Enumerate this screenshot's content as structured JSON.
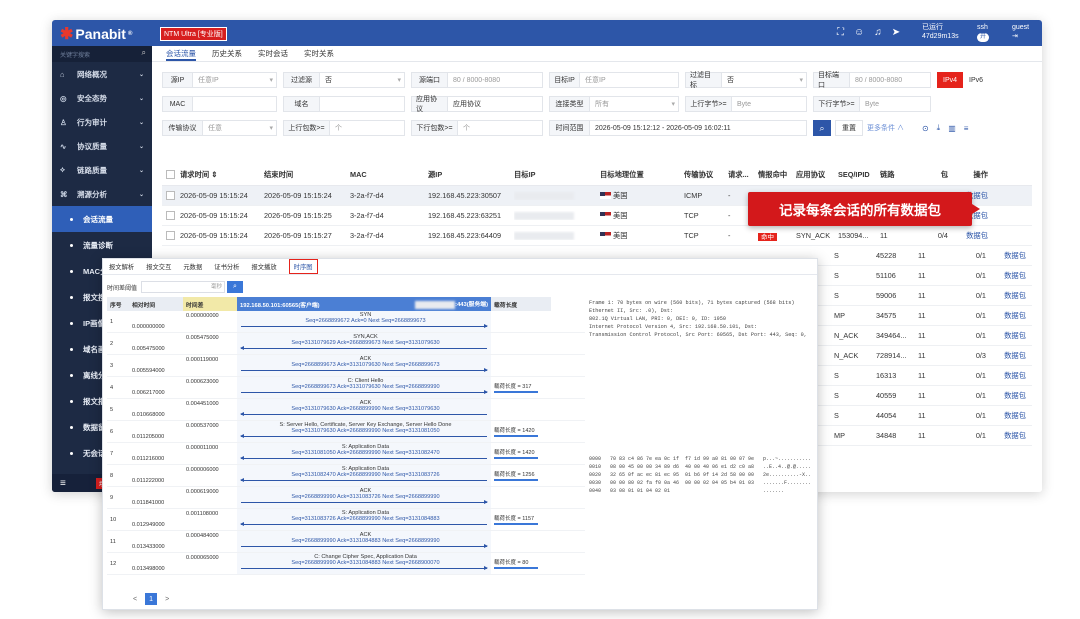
{
  "topbar": {
    "logo": "Panabit",
    "edition": "NTM Ultra [专业版]",
    "runtime_label": "已运行",
    "runtime": "47d29m13s",
    "user": "ssh",
    "user_toggle": "开",
    "guest": "guest"
  },
  "sidebar": {
    "search_placeholder": "关键字搜索",
    "items": [
      {
        "label": "网络概况",
        "icon": "home-icon"
      },
      {
        "label": "安全态势",
        "icon": "globe-icon"
      },
      {
        "label": "行为审计",
        "icon": "user-icon"
      },
      {
        "label": "协议质量",
        "icon": "pulse-icon"
      },
      {
        "label": "链路质量",
        "icon": "link-icon"
      },
      {
        "label": "溯源分析",
        "icon": "trace-icon"
      }
    ],
    "subitems": [
      "会话流量",
      "流量诊断",
      "MAC分析",
      "报文搜索",
      "IP画像",
      "域名画像",
      "离线分析",
      "报文播放",
      "数据留存",
      "无会话协议",
      "网卡抓包"
    ],
    "bottom_badge": "场景"
  },
  "tabs": [
    "会话流量",
    "历史关系",
    "实时会话",
    "实时关系"
  ],
  "filters": {
    "row1": [
      {
        "label": "源IP",
        "value": "任意IP"
      },
      {
        "label": "过滤源",
        "value": "否"
      },
      {
        "label": "源端口",
        "value": "80 / 8000-8080"
      },
      {
        "label": "目标IP",
        "value": "任意IP"
      },
      {
        "label": "过滤目标",
        "value": "否"
      },
      {
        "label": "目标端口",
        "value": "80 / 8000-8080"
      }
    ],
    "ipv4": "IPv4",
    "ipv6": "IPv6",
    "row2": [
      {
        "label": "MAC",
        "value": ""
      },
      {
        "label": "域名",
        "value": ""
      },
      {
        "label": "应用协议",
        "value": "应用协议"
      },
      {
        "label": "连接类型",
        "value": "所有"
      },
      {
        "label": "上行字节>=",
        "value": "Byte"
      },
      {
        "label": "下行字节>=",
        "value": "Byte"
      }
    ],
    "row3": [
      {
        "label": "传输协议",
        "value": "任意"
      },
      {
        "label": "上行包数>=",
        "value": "个"
      },
      {
        "label": "下行包数>=",
        "value": "个"
      },
      {
        "label": "时间范围",
        "value": "2026-05-09 15:12:12 - 2026-05-09 16:02:11"
      }
    ],
    "reset": "重置",
    "more": "更多条件"
  },
  "table": {
    "headers": [
      "请求时间",
      "结束时间",
      "MAC",
      "源IP",
      "目标IP",
      "目标地理位置",
      "传输协议",
      "请求...",
      "情报命中",
      "应用协议",
      "SEQ/IPID",
      "链路",
      "包",
      "操作"
    ],
    "rows": [
      {
        "start": "2026-05-09 15:15:24",
        "end": "2026-05-09 15:15:24",
        "mac": "3-2a-f7-d4",
        "src": "192.168.45.223:30507",
        "geo": "美国",
        "proto": "ICMP",
        "req": "-",
        "hit": "",
        "app": "",
        "seq": "",
        "link": "",
        "pk": "",
        "op": "数据包"
      },
      {
        "start": "2026-05-09 15:15:24",
        "end": "2026-05-09 15:15:25",
        "mac": "3-2a-f7-d4",
        "src": "192.168.45.223:63251",
        "geo": "美国",
        "proto": "TCP",
        "req": "-",
        "hit": "命中",
        "app": "SYN_ACK",
        "seq": "243092...",
        "link": "11",
        "pk": "0/2",
        "op": "数据包"
      },
      {
        "start": "2026-05-09 15:15:24",
        "end": "2026-05-09 15:15:27",
        "mac": "3-2a-f7-d4",
        "src": "192.168.45.223:64409",
        "geo": "美国",
        "proto": "TCP",
        "req": "-",
        "hit": "命中",
        "app": "SYN_ACK",
        "seq": "153094...",
        "link": "11",
        "pk": "0/4",
        "op": "数据包"
      }
    ],
    "extra_rows": [
      {
        "app": "S",
        "seq": "45228",
        "link": "11",
        "pk": "0/1",
        "op": "数据包"
      },
      {
        "app": "S",
        "seq": "51106",
        "link": "11",
        "pk": "0/1",
        "op": "数据包"
      },
      {
        "app": "S",
        "seq": "59006",
        "link": "11",
        "pk": "0/1",
        "op": "数据包"
      },
      {
        "app": "MP",
        "seq": "34575",
        "link": "11",
        "pk": "0/1",
        "op": "数据包"
      },
      {
        "app": "N_ACK",
        "seq": "349464...",
        "link": "11",
        "pk": "0/1",
        "op": "数据包"
      },
      {
        "app": "N_ACK",
        "seq": "728914...",
        "link": "11",
        "pk": "0/3",
        "op": "数据包"
      },
      {
        "app": "S",
        "seq": "16313",
        "link": "11",
        "pk": "0/1",
        "op": "数据包"
      },
      {
        "app": "S",
        "seq": "40559",
        "link": "11",
        "pk": "0/1",
        "op": "数据包"
      },
      {
        "app": "S",
        "seq": "44054",
        "link": "11",
        "pk": "0/1",
        "op": "数据包"
      },
      {
        "app": "MP",
        "seq": "34848",
        "link": "11",
        "pk": "0/1",
        "op": "数据包"
      }
    ]
  },
  "callout": "记录每条会话的所有数据包",
  "popup": {
    "tabs": [
      "报文解析",
      "报文交互",
      "元数据",
      "证书分析",
      "报文播放",
      "时序图"
    ],
    "search_label": "时间差阈值",
    "search_unit": "毫秒",
    "headers": {
      "no": "序号",
      "rel": "相对时间",
      "delta": "时间差",
      "client": "192.168.50.101:60565(客户端)",
      "server": ":443(服务端)",
      "payload": "载荷长度"
    },
    "rows": [
      {
        "n": "1",
        "rel": "0.000000000",
        "d": "0.000000000",
        "title": "SYN",
        "seq": "Seq=2668899672  Ack=0  Next Seq=2668899673",
        "dir": "r",
        "pl": ""
      },
      {
        "n": "2",
        "rel": "0.005475000",
        "d": "0.005475000",
        "title": "SYN,ACK",
        "seq": "Seq=3131079629  Ack=2668899673  Next Seq=3131079630",
        "dir": "l",
        "pl": ""
      },
      {
        "n": "3",
        "rel": "0.005594000",
        "d": "0.000119000",
        "title": "ACK",
        "seq": "Seq=2668899673  Ack=3131079630  Next Seq=2668899673",
        "dir": "r",
        "pl": ""
      },
      {
        "n": "4",
        "rel": "0.006217000",
        "d": "0.000623000",
        "title": "C: Client Hello",
        "seq": "Seq=2668899673  Ack=3131079630  Next Seq=2668899990",
        "dir": "r",
        "pl": "载荷长度 = 317"
      },
      {
        "n": "5",
        "rel": "0.010668000",
        "d": "0.004451000",
        "title": "ACK",
        "seq": "Seq=3131079630  Ack=2668899990  Next Seq=3131079630",
        "dir": "l",
        "pl": ""
      },
      {
        "n": "6",
        "rel": "0.011205000",
        "d": "0.000537000",
        "title": "S: Server Hello, Certificate, Server Key Exchange, Server Hello Done",
        "seq": "Seq=3131079630  Ack=2668899990  Next Seq=3131081050",
        "dir": "l",
        "pl": "载荷长度 = 1420"
      },
      {
        "n": "7",
        "rel": "0.011216000",
        "d": "0.000011000",
        "title": "S: Application Data",
        "seq": "Seq=3131081050  Ack=2668899990  Next Seq=3131082470",
        "dir": "l",
        "pl": "载荷长度 = 1420"
      },
      {
        "n": "8",
        "rel": "0.011222000",
        "d": "0.000006000",
        "title": "S: Application Data",
        "seq": "Seq=3131082470  Ack=2668899990  Next Seq=3131083726",
        "dir": "l",
        "pl": "载荷长度 = 1256"
      },
      {
        "n": "9",
        "rel": "0.011841000",
        "d": "0.000619000",
        "title": "ACK",
        "seq": "Seq=2668899990  Ack=3131083726  Next Seq=2668899990",
        "dir": "r",
        "pl": ""
      },
      {
        "n": "10",
        "rel": "0.012949000",
        "d": "0.001108000",
        "title": "S: Application Data",
        "seq": "Seq=3131083726  Ack=2668899990  Next Seq=3131084883",
        "dir": "l",
        "pl": "载荷长度 = 1157"
      },
      {
        "n": "11",
        "rel": "0.013433000",
        "d": "0.000484000",
        "title": "ACK",
        "seq": "Seq=2668899990  Ack=3131084883  Next Seq=2668899990",
        "dir": "r",
        "pl": ""
      },
      {
        "n": "12",
        "rel": "0.013498000",
        "d": "0.000065000",
        "title": "C: Change Cipher Spec, Application Data",
        "seq": "Seq=2668899990  Ack=3131084883  Next Seq=2668900070",
        "dir": "r",
        "pl": "载荷长度 = 80"
      }
    ],
    "detail": [
      "Frame 1: 70 bytes on wire (560 bits), 71 bytes captured (568 bits)",
      "Ethernet II, Src:                              .0), Dst:",
      "802.1Q Virtual LAN, PRI: 0, DEI: 0, ID: 1950",
      "Internet Protocol Version 4, Src: 192.168.50.101, Dst:",
      "Transmission Control Protocol, Src Port: 60565, Dst Port: 443, Seq: 0,"
    ],
    "hex": [
      "0000   70 83 c4 86 7e ea 0c 1f  f7 1d 99 a0 81 00 07 9e   p...~...........",
      "0010   08 00 45 00 00 34 89 d6  40 00 40 06 e1 d2 c0 a8   ..E..4..@.@.....",
      "0020   32 65 0f ac ec 81 ec 95  01 b6 9f 14 2d 58 00 00   2e..........-X..",
      "0030   00 00 80 02 fa f0 0a 46  00 00 02 04 05 b4 01 03   .......F........",
      "0040   03 08 01 01 04 02 01                               ......."
    ],
    "page": "1"
  }
}
